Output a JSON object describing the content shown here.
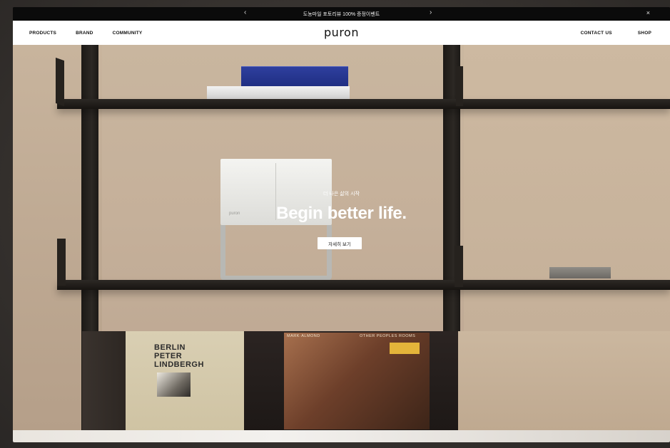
{
  "announcement": {
    "text": "도농마일 포토리뷰 100% 증정이벤트",
    "prev_glyph": "‹",
    "next_glyph": "›",
    "close_glyph": "×"
  },
  "header": {
    "logo": "puron",
    "nav_left": [
      "PRODUCTS",
      "BRAND",
      "COMMUNITY"
    ],
    "nav_right": [
      "CONTACT US",
      "SHOP"
    ]
  },
  "hero": {
    "subtitle": "더 나은 삶의 시작",
    "title": "Begin better life.",
    "cta_label": "자세히 보기",
    "product_brand": "puron",
    "record_left_title": "BERLIN\nPETER\nLINDBERGH",
    "record_right_text_left": "MARK·ALMOND",
    "record_right_text_right": "OTHER PEOPLES ROOMS",
    "pause_icon": "pause-icon"
  },
  "colors": {
    "announcement_bg": "#0b0b0b",
    "header_bg": "#ffffff",
    "text_dark": "#111111",
    "cta_bg": "#ffffff"
  }
}
